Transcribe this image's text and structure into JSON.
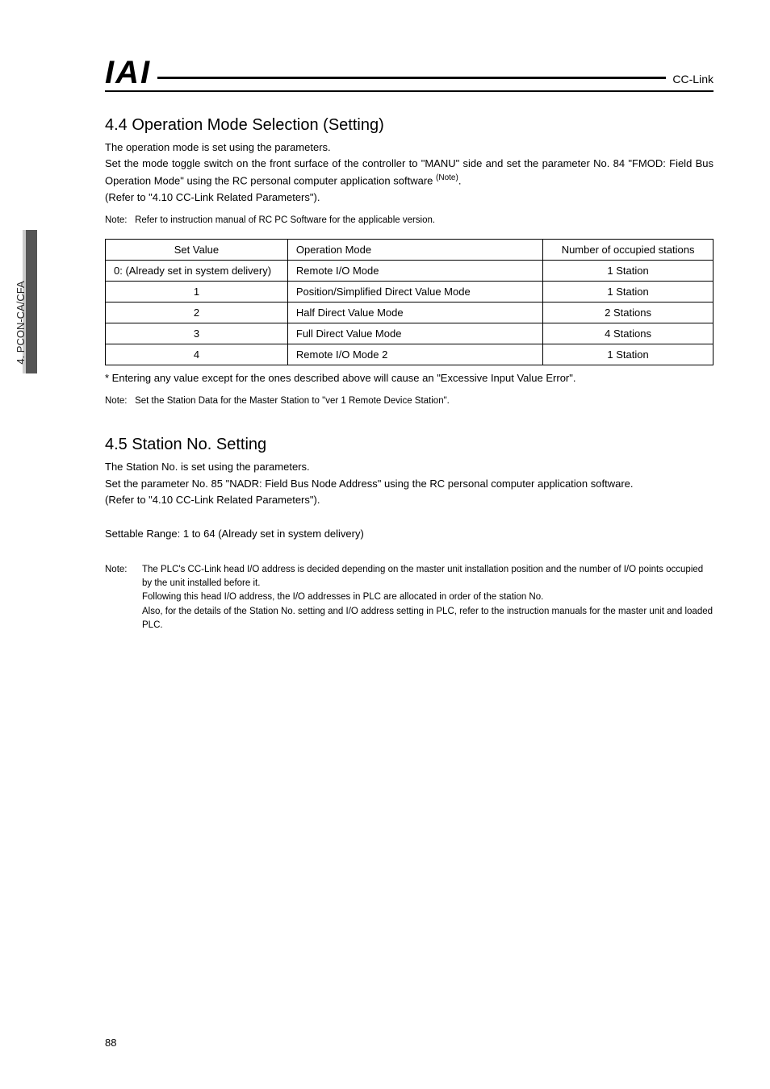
{
  "side_label": "4. PCON-CA/CFA",
  "header": {
    "logo": "IAI",
    "right": "CC-Link"
  },
  "sec44": {
    "title": "4.4  Operation Mode Selection (Setting)",
    "p1": "The operation mode is set using the parameters.",
    "p2a": "Set the mode toggle switch on the front surface of the controller to \"MANU\" side and set the parameter No. 84 \"FMOD: Field Bus Operation Mode\" using the RC personal computer application software ",
    "p2_sup": "(Note)",
    "p2b": ".",
    "p3": "(Refer to \"4.10 CC-Link Related Parameters\").",
    "note_label": "Note:",
    "note_text": "Refer to instruction manual of RC PC Software for the applicable version.",
    "table": {
      "h1": "Set Value",
      "h2": "Operation Mode",
      "h3": "Number of occupied stations",
      "rows": [
        {
          "sv": "0: (Already set in system delivery)",
          "sv_align": "left",
          "op": "Remote I/O Mode",
          "num": "1 Station"
        },
        {
          "sv": "1",
          "sv_align": "center",
          "op": "Position/Simplified Direct Value Mode",
          "num": "1 Station"
        },
        {
          "sv": "2",
          "sv_align": "center",
          "op": "Half Direct Value Mode",
          "num": "2 Stations"
        },
        {
          "sv": "3",
          "sv_align": "center",
          "op": "Full Direct Value Mode",
          "num": "4 Stations"
        },
        {
          "sv": "4",
          "sv_align": "center",
          "op": "Remote I/O Mode 2",
          "num": "1 Station"
        }
      ]
    },
    "after_table": "*   Entering any value except for the ones described above will cause an \"Excessive Input Value Error\".",
    "note2_label": "Note:",
    "note2_text": "Set the Station Data for the Master Station to \"ver 1 Remote Device Station\"."
  },
  "sec45": {
    "title": "4.5  Station No. Setting",
    "p1": "The Station No. is set using the parameters.",
    "p2": "Set the parameter No. 85 \"NADR: Field Bus Node Address\" using the RC personal computer application software.",
    "p3": "(Refer to \"4.10 CC-Link Related Parameters\").",
    "range": "Settable Range: 1 to 64 (Already set in system delivery)",
    "note_label": "Note:",
    "note_l1": "The PLC's CC-Link head I/O address is decided depending on the master unit installation position and the number of I/O points occupied by the unit installed before it.",
    "note_l2": "Following this head I/O address, the I/O addresses in PLC are allocated in order of the station No.",
    "note_l3": "Also, for the details of the Station No. setting and I/O address setting in PLC, refer to the instruction manuals for the master unit and loaded PLC."
  },
  "page_number": "88"
}
